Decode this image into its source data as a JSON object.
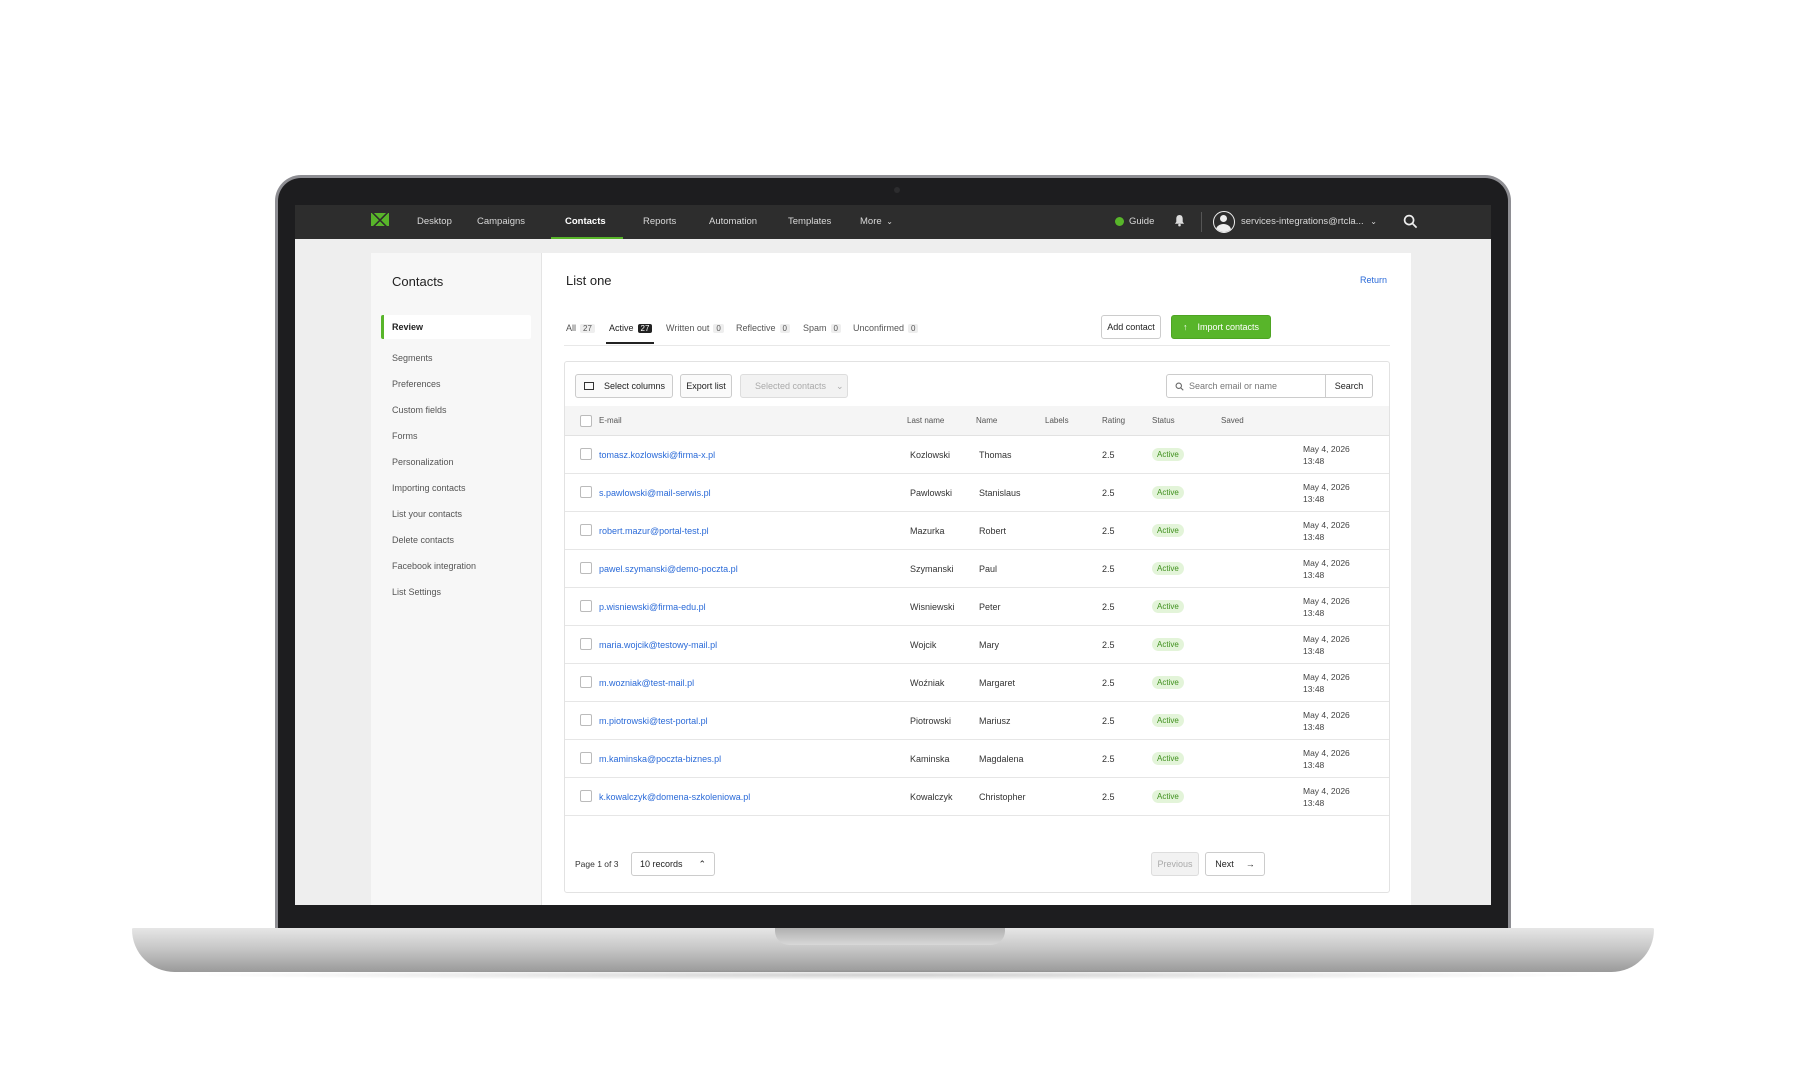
{
  "nav": {
    "items": [
      "Desktop",
      "Campaigns",
      "Contacts",
      "Reports",
      "Automation",
      "Templates",
      "More"
    ],
    "active": "Contacts",
    "guide_label": "Guide",
    "account_label": "services-integrations@rtcla..."
  },
  "sidebar": {
    "title": "Contacts",
    "items": [
      "Review",
      "Segments",
      "Preferences",
      "Custom fields",
      "Forms",
      "Personalization",
      "Importing contacts",
      "List your contacts",
      "Delete contacts",
      "Facebook integration",
      "List Settings"
    ]
  },
  "main": {
    "title": "List one",
    "return_label": "Return",
    "tabs": [
      {
        "label": "All",
        "count": "27"
      },
      {
        "label": "Active",
        "count": "27"
      },
      {
        "label": "Written out",
        "count": "0"
      },
      {
        "label": "Reflective",
        "count": "0"
      },
      {
        "label": "Spam",
        "count": "0"
      },
      {
        "label": "Unconfirmed",
        "count": "0"
      }
    ],
    "add_contact_label": "Add contact",
    "import_contacts_label": "Import contacts"
  },
  "toolbar": {
    "select_columns_label": "Select columns",
    "export_list_label": "Export list",
    "selected_contacts_label": "Selected contacts",
    "search_placeholder": "Search email or name",
    "search_button_label": "Search"
  },
  "table": {
    "headers": [
      "E-mail",
      "Last name",
      "Name",
      "Labels",
      "Rating",
      "Status",
      "Saved"
    ],
    "rows": [
      {
        "email": "tomasz.kozlowski@firma-x.pl",
        "last_name": "Kozlowski",
        "name": "Thomas",
        "labels": "",
        "rating": "2.5",
        "status": "Active",
        "saved_date": "May 4, 2026",
        "saved_time": "13:48"
      },
      {
        "email": "s.pawlowski@mail-serwis.pl",
        "last_name": "Pawlowski",
        "name": "Stanislaus",
        "labels": "",
        "rating": "2.5",
        "status": "Active",
        "saved_date": "May 4, 2026",
        "saved_time": "13:48"
      },
      {
        "email": "robert.mazur@portal-test.pl",
        "last_name": "Mazurka",
        "name": "Robert",
        "labels": "",
        "rating": "2.5",
        "status": "Active",
        "saved_date": "May 4, 2026",
        "saved_time": "13:48"
      },
      {
        "email": "pawel.szymanski@demo-poczta.pl",
        "last_name": "Szymanski",
        "name": "Paul",
        "labels": "",
        "rating": "2.5",
        "status": "Active",
        "saved_date": "May 4, 2026",
        "saved_time": "13:48"
      },
      {
        "email": "p.wisniewski@firma-edu.pl",
        "last_name": "Wisniewski",
        "name": "Peter",
        "labels": "",
        "rating": "2.5",
        "status": "Active",
        "saved_date": "May 4, 2026",
        "saved_time": "13:48"
      },
      {
        "email": "maria.wojcik@testowy-mail.pl",
        "last_name": "Wojcik",
        "name": "Mary",
        "labels": "",
        "rating": "2.5",
        "status": "Active",
        "saved_date": "May 4, 2026",
        "saved_time": "13:48"
      },
      {
        "email": "m.wozniak@test-mail.pl",
        "last_name": "Woźniak",
        "name": "Margaret",
        "labels": "",
        "rating": "2.5",
        "status": "Active",
        "saved_date": "May 4, 2026",
        "saved_time": "13:48"
      },
      {
        "email": "m.piotrowski@test-portal.pl",
        "last_name": "Piotrowski",
        "name": "Mariusz",
        "labels": "",
        "rating": "2.5",
        "status": "Active",
        "saved_date": "May 4, 2026",
        "saved_time": "13:48"
      },
      {
        "email": "m.kaminska@poczta-biznes.pl",
        "last_name": "Kaminska",
        "name": "Magdalena",
        "labels": "",
        "rating": "2.5",
        "status": "Active",
        "saved_date": "May 4, 2026",
        "saved_time": "13:48"
      },
      {
        "email": "k.kowalczyk@domena-szkoleniowa.pl",
        "last_name": "Kowalczyk",
        "name": "Christopher",
        "labels": "",
        "rating": "2.5",
        "status": "Active",
        "saved_date": "May 4, 2026",
        "saved_time": "13:48"
      }
    ]
  },
  "pagination": {
    "page_label": "Page 1 of 3",
    "records_label": "10 records",
    "previous_label": "Previous",
    "next_label": "Next"
  },
  "colors": {
    "accent": "#58b52a",
    "link": "#2a6ad8",
    "nav_bg": "#2d2d2d"
  }
}
